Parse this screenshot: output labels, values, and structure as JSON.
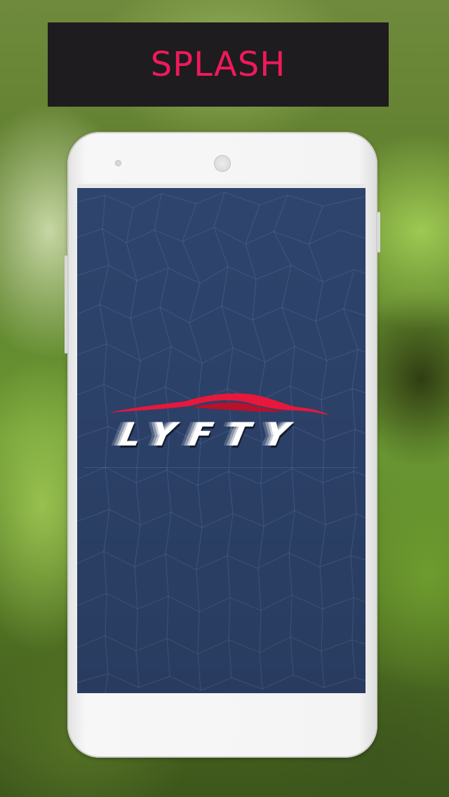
{
  "header": {
    "title": "SPLASH",
    "title_color": "#f0195a",
    "background_color": "#1e1c1e"
  },
  "device": {
    "type": "phone",
    "color": "#f4f4f4"
  },
  "splash_screen": {
    "background_color": "#2c4168",
    "logo": {
      "text": "LYFTY",
      "car_swoosh_color": "#e8173c",
      "text_color": "#ffffff",
      "icon": "sports-car-outline-icon"
    }
  }
}
